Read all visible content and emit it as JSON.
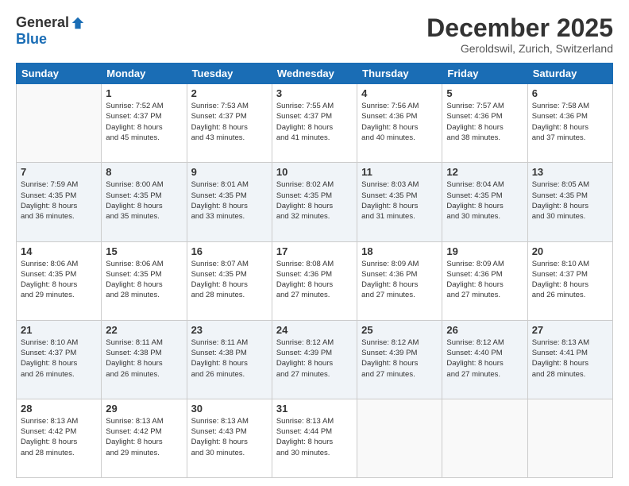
{
  "logo": {
    "general": "General",
    "blue": "Blue"
  },
  "header": {
    "month": "December 2025",
    "location": "Geroldswil, Zurich, Switzerland"
  },
  "weekdays": [
    "Sunday",
    "Monday",
    "Tuesday",
    "Wednesday",
    "Thursday",
    "Friday",
    "Saturday"
  ],
  "weeks": [
    [
      {
        "day": "",
        "info": ""
      },
      {
        "day": "1",
        "info": "Sunrise: 7:52 AM\nSunset: 4:37 PM\nDaylight: 8 hours\nand 45 minutes."
      },
      {
        "day": "2",
        "info": "Sunrise: 7:53 AM\nSunset: 4:37 PM\nDaylight: 8 hours\nand 43 minutes."
      },
      {
        "day": "3",
        "info": "Sunrise: 7:55 AM\nSunset: 4:37 PM\nDaylight: 8 hours\nand 41 minutes."
      },
      {
        "day": "4",
        "info": "Sunrise: 7:56 AM\nSunset: 4:36 PM\nDaylight: 8 hours\nand 40 minutes."
      },
      {
        "day": "5",
        "info": "Sunrise: 7:57 AM\nSunset: 4:36 PM\nDaylight: 8 hours\nand 38 minutes."
      },
      {
        "day": "6",
        "info": "Sunrise: 7:58 AM\nSunset: 4:36 PM\nDaylight: 8 hours\nand 37 minutes."
      }
    ],
    [
      {
        "day": "7",
        "info": "Sunrise: 7:59 AM\nSunset: 4:35 PM\nDaylight: 8 hours\nand 36 minutes."
      },
      {
        "day": "8",
        "info": "Sunrise: 8:00 AM\nSunset: 4:35 PM\nDaylight: 8 hours\nand 35 minutes."
      },
      {
        "day": "9",
        "info": "Sunrise: 8:01 AM\nSunset: 4:35 PM\nDaylight: 8 hours\nand 33 minutes."
      },
      {
        "day": "10",
        "info": "Sunrise: 8:02 AM\nSunset: 4:35 PM\nDaylight: 8 hours\nand 32 minutes."
      },
      {
        "day": "11",
        "info": "Sunrise: 8:03 AM\nSunset: 4:35 PM\nDaylight: 8 hours\nand 31 minutes."
      },
      {
        "day": "12",
        "info": "Sunrise: 8:04 AM\nSunset: 4:35 PM\nDaylight: 8 hours\nand 30 minutes."
      },
      {
        "day": "13",
        "info": "Sunrise: 8:05 AM\nSunset: 4:35 PM\nDaylight: 8 hours\nand 30 minutes."
      }
    ],
    [
      {
        "day": "14",
        "info": "Sunrise: 8:06 AM\nSunset: 4:35 PM\nDaylight: 8 hours\nand 29 minutes."
      },
      {
        "day": "15",
        "info": "Sunrise: 8:06 AM\nSunset: 4:35 PM\nDaylight: 8 hours\nand 28 minutes."
      },
      {
        "day": "16",
        "info": "Sunrise: 8:07 AM\nSunset: 4:35 PM\nDaylight: 8 hours\nand 28 minutes."
      },
      {
        "day": "17",
        "info": "Sunrise: 8:08 AM\nSunset: 4:36 PM\nDaylight: 8 hours\nand 27 minutes."
      },
      {
        "day": "18",
        "info": "Sunrise: 8:09 AM\nSunset: 4:36 PM\nDaylight: 8 hours\nand 27 minutes."
      },
      {
        "day": "19",
        "info": "Sunrise: 8:09 AM\nSunset: 4:36 PM\nDaylight: 8 hours\nand 27 minutes."
      },
      {
        "day": "20",
        "info": "Sunrise: 8:10 AM\nSunset: 4:37 PM\nDaylight: 8 hours\nand 26 minutes."
      }
    ],
    [
      {
        "day": "21",
        "info": "Sunrise: 8:10 AM\nSunset: 4:37 PM\nDaylight: 8 hours\nand 26 minutes."
      },
      {
        "day": "22",
        "info": "Sunrise: 8:11 AM\nSunset: 4:38 PM\nDaylight: 8 hours\nand 26 minutes."
      },
      {
        "day": "23",
        "info": "Sunrise: 8:11 AM\nSunset: 4:38 PM\nDaylight: 8 hours\nand 26 minutes."
      },
      {
        "day": "24",
        "info": "Sunrise: 8:12 AM\nSunset: 4:39 PM\nDaylight: 8 hours\nand 27 minutes."
      },
      {
        "day": "25",
        "info": "Sunrise: 8:12 AM\nSunset: 4:39 PM\nDaylight: 8 hours\nand 27 minutes."
      },
      {
        "day": "26",
        "info": "Sunrise: 8:12 AM\nSunset: 4:40 PM\nDaylight: 8 hours\nand 27 minutes."
      },
      {
        "day": "27",
        "info": "Sunrise: 8:13 AM\nSunset: 4:41 PM\nDaylight: 8 hours\nand 28 minutes."
      }
    ],
    [
      {
        "day": "28",
        "info": "Sunrise: 8:13 AM\nSunset: 4:42 PM\nDaylight: 8 hours\nand 28 minutes."
      },
      {
        "day": "29",
        "info": "Sunrise: 8:13 AM\nSunset: 4:42 PM\nDaylight: 8 hours\nand 29 minutes."
      },
      {
        "day": "30",
        "info": "Sunrise: 8:13 AM\nSunset: 4:43 PM\nDaylight: 8 hours\nand 30 minutes."
      },
      {
        "day": "31",
        "info": "Sunrise: 8:13 AM\nSunset: 4:44 PM\nDaylight: 8 hours\nand 30 minutes."
      },
      {
        "day": "",
        "info": ""
      },
      {
        "day": "",
        "info": ""
      },
      {
        "day": "",
        "info": ""
      }
    ]
  ]
}
